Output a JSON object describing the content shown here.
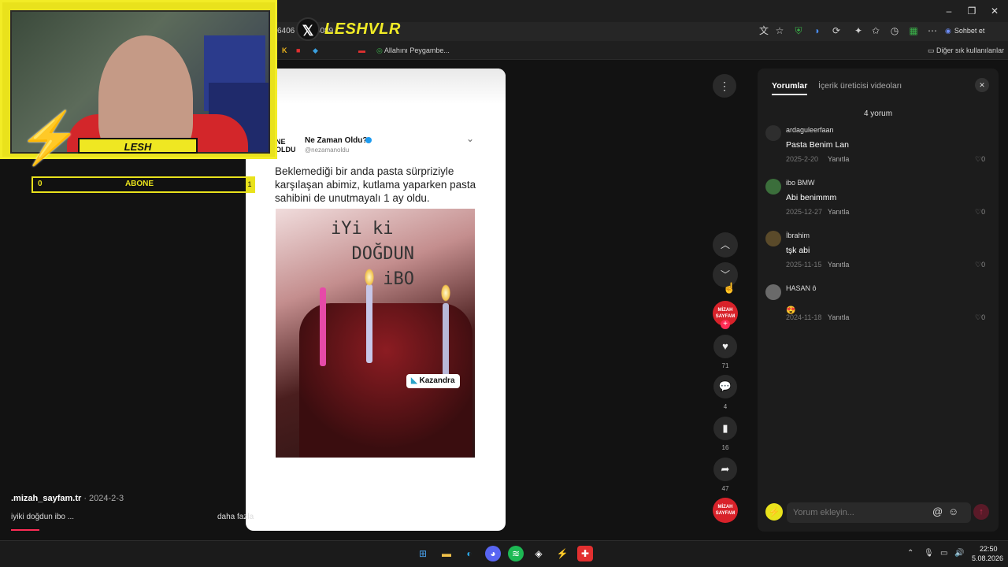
{
  "browser": {
    "url": "6406 … 415089",
    "sohbet_label": "Sohbet et",
    "other_bookmarks": "Diğer sık kullanılanlar",
    "bookmark_item": "Allahını Peygambe...",
    "bookmark_k": "K"
  },
  "overlay": {
    "streamer_name": "LESH",
    "brand": "LESHVLR",
    "subscriber_count": "0",
    "subscriber_label": "ABONE",
    "subscriber_end": "1"
  },
  "tweet": {
    "account_name": "Ne Zaman Oldu?",
    "handle": "@nezamanoldu",
    "logo_text": "NE OLDU",
    "text": "Beklemediği bir anda pasta sürpriziyle karşılaşan abimiz, kutlama yaparken pasta sahibini de unutmayalı 1 ay oldu.",
    "photo_writing": "iYi ki\n  DOĞDUN\n     iBO",
    "watermark": "Kazandra"
  },
  "video_info": {
    "author": ".mizah_sayfam.tr",
    "date": " · 2024-2-3",
    "description": "iyiki doğdun ibo ...",
    "more": "daha fazla"
  },
  "actions": {
    "avatar_text": "MİZAH SAYFAM",
    "likes": "71",
    "comments": "4",
    "saves": "16",
    "shares": "47"
  },
  "panel": {
    "tab_comments": "Yorumlar",
    "tab_creator": "İçerik üreticisi videoları",
    "count": "4 yorum",
    "reply_label": "Yanıtla",
    "input_placeholder": "Yorum ekleyin...",
    "comments": [
      {
        "user": "ardaguleerfaan",
        "text": "Pasta Benim Lan",
        "date": "2025-2-20",
        "likes": "0"
      },
      {
        "user": "ibo BMW",
        "text": "Abi benimmm",
        "date": "2025-12-27",
        "likes": "0"
      },
      {
        "user": "İbrahim",
        "text": "tşk abi",
        "date": "2025-11-15",
        "likes": "0"
      },
      {
        "user": "HASAN ô",
        "text": "",
        "date": "2024-11-18",
        "likes": "0"
      }
    ]
  },
  "taskbar": {
    "time": "22:50",
    "date": "5.08.2026"
  }
}
